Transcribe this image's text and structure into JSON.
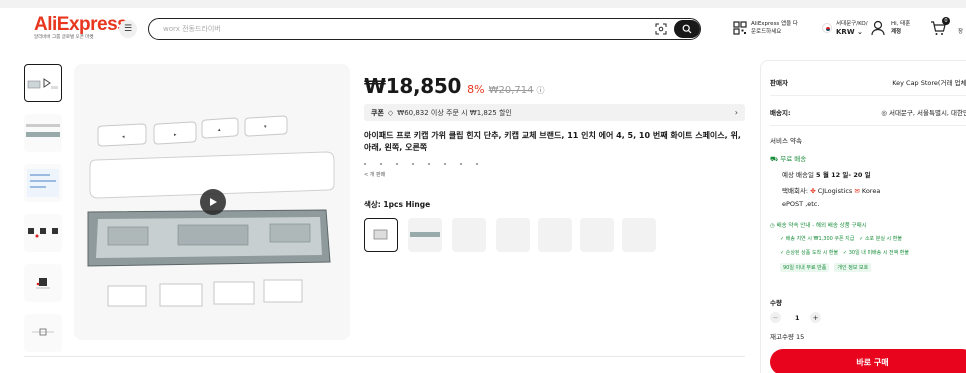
{
  "header": {
    "logo": "AliExpress",
    "logo_sub": "알리바바 그룹 글로벌 오픈 마켓",
    "search_placeholder": "worx 전동드라이버",
    "app_line1": "AliExpress 앱을 다",
    "app_line2": "운로드하세요",
    "region_line1": "서대문구/KO/",
    "region_currency": "KRW ⌄",
    "user_line1": "Hi, 태훈",
    "user_line2": "계정",
    "cart_count": "0",
    "cart_label": "장"
  },
  "product": {
    "price": "₩18,850",
    "discount": "8%",
    "original_price": "₩20,714",
    "coupon_label": "쿠폰",
    "coupon_text": "₩60,832 이상 주문 시 ₩1,825 할인",
    "title": "아이패드 프로 키캡 가위 클립 힌지 단추, 키캡 교체 브랜드, 11 인치 에어 4, 5, 10 번째 화이트 스페이스, 위, 아래, 왼쪽, 오른쪽",
    "more_link": "< 개 판매",
    "color_label": "색상: 1pcs Hinge"
  },
  "panel": {
    "seller_label": "판매자",
    "seller_name": "Key Cap Store(거래 업체)",
    "ship_to_label": "배송지:",
    "ship_to_value": "◎ 서대문구, 서울특별시, 대한민",
    "service_title": "서비스 약속",
    "free_shipping": "무료 배송",
    "delivery_prefix": "예상 배송일",
    "delivery_date": "5 월 12 일- 20 일",
    "carrier_prefix": "택배회사:",
    "carrier_main": "CJLogistics",
    "carrier_korea": "Korea",
    "carrier_more": "ePOST ,etc.",
    "promise_title": "배송 약속 안내 - 해외 배송 상품 구매시",
    "promise_1a": "✓ 배송 지연 시 ₩1,300 쿠폰 지급",
    "promise_1b": "✓ 소포 분실 시 환불",
    "promise_2a": "✓ 손상된 상품 도착 시 환불",
    "promise_2b": "✓ 30일 내 미배송 시 전액 환불",
    "tag_1": "90일 이내 무료 반품",
    "tag_2": "개인 정보 보호",
    "qty_label": "수량",
    "qty_value": "1",
    "stock_text": "재고수량 15",
    "buy_now": "바로 구매"
  }
}
